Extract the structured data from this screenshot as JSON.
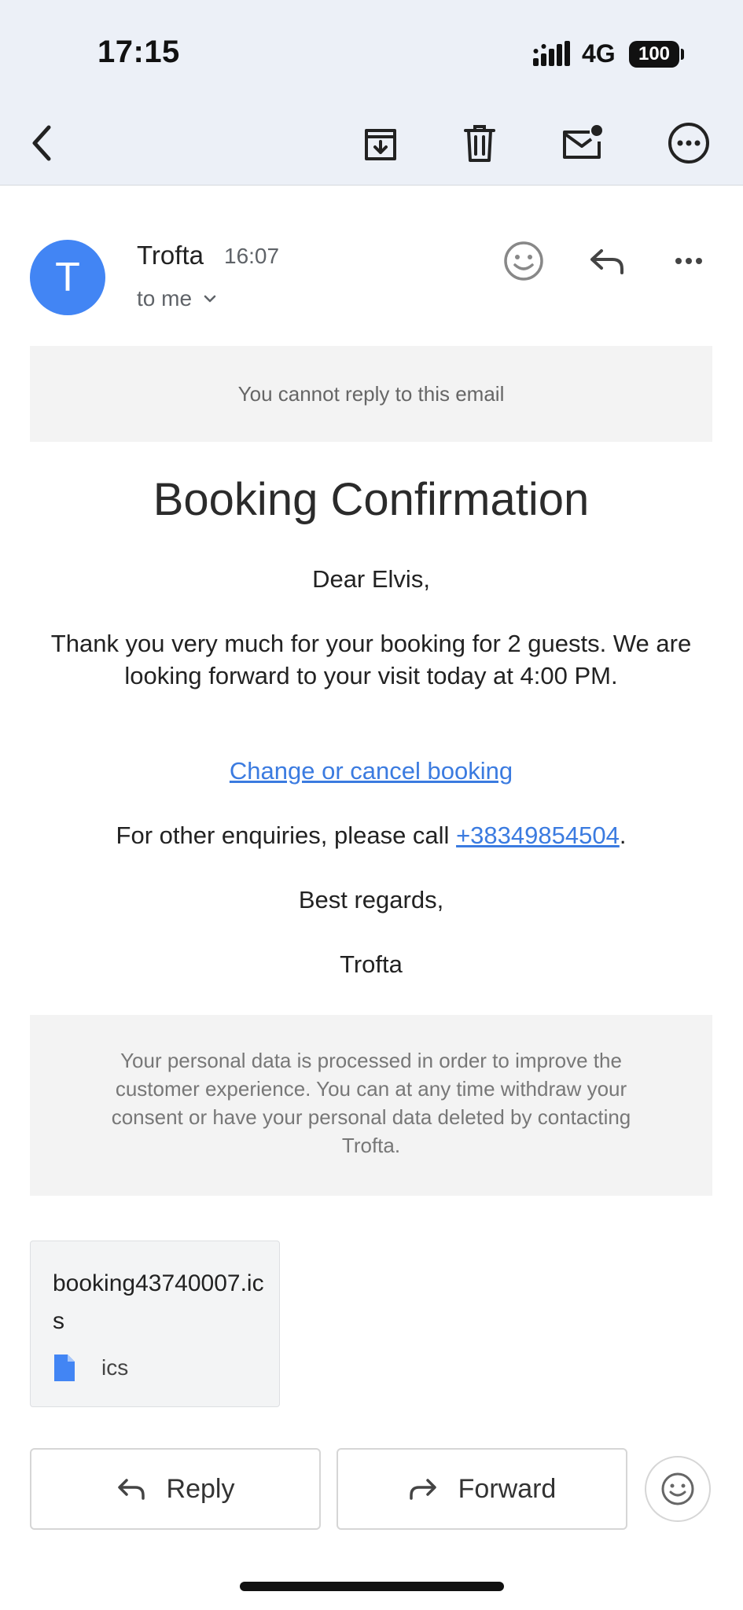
{
  "status_bar": {
    "time": "17:15",
    "network": "4G",
    "battery": "100"
  },
  "toolbar": {
    "back_icon": "chevron-left-icon",
    "archive_icon": "archive-icon",
    "delete_icon": "trash-icon",
    "mark_unread_icon": "mail-unread-icon",
    "more_icon": "more-circle-icon"
  },
  "message": {
    "avatar_letter": "T",
    "sender": "Trofta",
    "time": "16:07",
    "recipient": "to me",
    "notice": "You cannot reply to this email",
    "title": "Booking Confirmation",
    "greeting": "Dear Elvis,",
    "body": "Thank you very much for your booking for 2 guests. We are looking forward to your visit today at 4:00 PM.",
    "change_link": "Change or cancel booking",
    "enquiries_prefix": "For other enquiries, please call ",
    "phone": "+38349854504",
    "enquiries_suffix": ".",
    "regards": "Best regards,",
    "signature": "Trofta",
    "privacy": "Your personal data is processed in order to improve the customer experience. You can at any time withdraw your consent or have your personal data deleted by contacting Trofta."
  },
  "attachment": {
    "name": "booking43740007.ics",
    "type": "ics"
  },
  "actions": {
    "reply": "Reply",
    "forward": "Forward"
  },
  "colors": {
    "accent": "#4285f4",
    "link": "#3b7be0",
    "panel": "#f3f3f3",
    "toolbar_bg": "#ecf0f7"
  }
}
